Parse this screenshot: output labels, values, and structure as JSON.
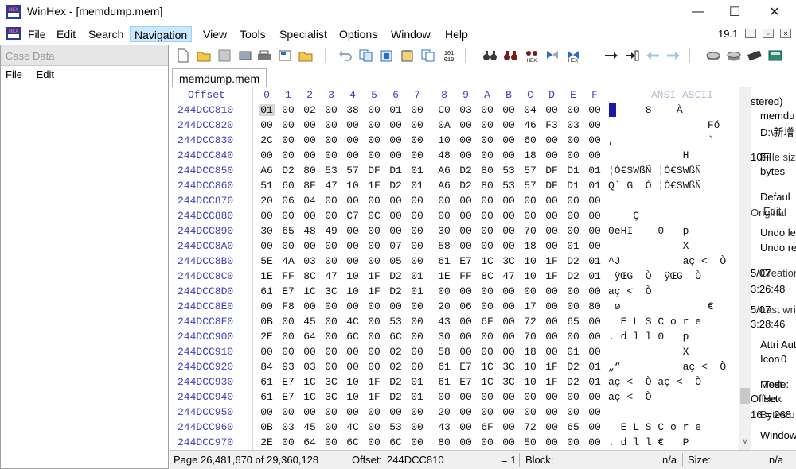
{
  "window": {
    "title": "WinHex - [memdump.mem]",
    "minimize_glyph": "—",
    "maximize_glyph": "☐",
    "close_glyph": "✕"
  },
  "menubar": {
    "items": [
      "File",
      "Edit",
      "Search",
      "Navigation",
      "View",
      "Tools",
      "Specialist",
      "Options",
      "Window",
      "Help"
    ],
    "active": "Navigation",
    "version": "19.1"
  },
  "case_panel": {
    "header": "Case Data",
    "menu": [
      "File",
      "Edit"
    ]
  },
  "toolbar": {
    "icons": [
      "new-file-icon",
      "open-folder-icon",
      "save-icon",
      "print-icon",
      "printer-icon",
      "properties-icon",
      "open-folder-2-icon",
      "undo-icon",
      "copy-icon",
      "paste-icon",
      "paste-special-icon",
      "copy-block-icon",
      "binary-icon",
      "find-text-icon",
      "find-hex-icon",
      "replace-text-icon",
      "replace-hex-icon",
      "hex-search-icon",
      "goto-offset-icon",
      "goto-sector-icon",
      "back-icon",
      "forward-icon",
      "open-disk-icon",
      "open-disks-icon",
      "ram-icon",
      "calculator-icon"
    ],
    "accent_blue": "#2b6cc4",
    "accent_gray": "#9aa6b8"
  },
  "tab": {
    "label": "memdump.mem"
  },
  "hex": {
    "offset_label": "Offset",
    "columns": [
      "0",
      "1",
      "2",
      "3",
      "4",
      "5",
      "6",
      "7",
      "8",
      "9",
      "A",
      "B",
      "C",
      "D",
      "E",
      "F"
    ],
    "ansi_label": "ANSI ASCII",
    "rows": [
      {
        "addr": "244DCC810",
        "bytes": [
          "01",
          "00",
          "02",
          "00",
          "38",
          "00",
          "01",
          "00",
          "C0",
          "03",
          "00",
          "00",
          "04",
          "00",
          "00",
          "00"
        ],
        "ascii": "      8    À"
      },
      {
        "addr": "244DCC820",
        "bytes": [
          "00",
          "00",
          "00",
          "00",
          "00",
          "00",
          "00",
          "00",
          "0A",
          "00",
          "00",
          "00",
          "46",
          "F3",
          "03",
          "00"
        ],
        "ascii": "                Fó"
      },
      {
        "addr": "244DCC830",
        "bytes": [
          "2C",
          "00",
          "00",
          "00",
          "00",
          "00",
          "00",
          "00",
          "10",
          "00",
          "00",
          "00",
          "60",
          "00",
          "00",
          "00"
        ],
        "ascii": ",               `"
      },
      {
        "addr": "244DCC840",
        "bytes": [
          "00",
          "00",
          "00",
          "00",
          "00",
          "00",
          "00",
          "00",
          "48",
          "00",
          "00",
          "00",
          "18",
          "00",
          "00",
          "00"
        ],
        "ascii": "            H"
      },
      {
        "addr": "244DCC850",
        "bytes": [
          "A6",
          "D2",
          "80",
          "53",
          "57",
          "DF",
          "D1",
          "01",
          "A6",
          "D2",
          "80",
          "53",
          "57",
          "DF",
          "D1",
          "01"
        ],
        "ascii": "¦Ò€SWßÑ ¦Ò€SWßÑ"
      },
      {
        "addr": "244DCC860",
        "bytes": [
          "51",
          "60",
          "8F",
          "47",
          "10",
          "1F",
          "D2",
          "01",
          "A6",
          "D2",
          "80",
          "53",
          "57",
          "DF",
          "D1",
          "01"
        ],
        "ascii": "Q` G  Ò ¦Ò€SWßÑ"
      },
      {
        "addr": "244DCC870",
        "bytes": [
          "20",
          "06",
          "04",
          "00",
          "00",
          "00",
          "00",
          "00",
          "00",
          "00",
          "00",
          "00",
          "00",
          "00",
          "00",
          "00"
        ],
        "ascii": ""
      },
      {
        "addr": "244DCC880",
        "bytes": [
          "00",
          "00",
          "00",
          "00",
          "C7",
          "0C",
          "00",
          "00",
          "00",
          "00",
          "00",
          "00",
          "00",
          "00",
          "00",
          "00"
        ],
        "ascii": "    Ç"
      },
      {
        "addr": "244DCC890",
        "bytes": [
          "30",
          "65",
          "48",
          "49",
          "00",
          "00",
          "00",
          "00",
          "30",
          "00",
          "00",
          "00",
          "70",
          "00",
          "00",
          "00"
        ],
        "ascii": "0eHI    0   p"
      },
      {
        "addr": "244DCC8A0",
        "bytes": [
          "00",
          "00",
          "00",
          "00",
          "00",
          "00",
          "07",
          "00",
          "58",
          "00",
          "00",
          "00",
          "18",
          "00",
          "01",
          "00"
        ],
        "ascii": "            X"
      },
      {
        "addr": "244DCC8B0",
        "bytes": [
          "5E",
          "4A",
          "03",
          "00",
          "00",
          "00",
          "05",
          "00",
          "61",
          "E7",
          "1C",
          "3C",
          "10",
          "1F",
          "D2",
          "01"
        ],
        "ascii": "^J          aç <  Ò"
      },
      {
        "addr": "244DCC8C0",
        "bytes": [
          "1E",
          "FF",
          "8C",
          "47",
          "10",
          "1F",
          "D2",
          "01",
          "1E",
          "FF",
          "8C",
          "47",
          "10",
          "1F",
          "D2",
          "01"
        ],
        "ascii": " ÿŒG  Ò  ÿŒG  Ò"
      },
      {
        "addr": "244DCC8D0",
        "bytes": [
          "61",
          "E7",
          "1C",
          "3C",
          "10",
          "1F",
          "D2",
          "01",
          "00",
          "00",
          "00",
          "00",
          "00",
          "00",
          "00",
          "00"
        ],
        "ascii": "aç <  Ò"
      },
      {
        "addr": "244DCC8E0",
        "bytes": [
          "00",
          "F8",
          "00",
          "00",
          "00",
          "00",
          "00",
          "00",
          "20",
          "06",
          "00",
          "00",
          "17",
          "00",
          "00",
          "80"
        ],
        "ascii": " ø              €"
      },
      {
        "addr": "244DCC8F0",
        "bytes": [
          "0B",
          "00",
          "45",
          "00",
          "4C",
          "00",
          "53",
          "00",
          "43",
          "00",
          "6F",
          "00",
          "72",
          "00",
          "65",
          "00"
        ],
        "ascii": "  E L S C o r e"
      },
      {
        "addr": "244DCC900",
        "bytes": [
          "2E",
          "00",
          "64",
          "00",
          "6C",
          "00",
          "6C",
          "00",
          "30",
          "00",
          "00",
          "00",
          "70",
          "00",
          "00",
          "00"
        ],
        "ascii": ". d l l 0   p"
      },
      {
        "addr": "244DCC910",
        "bytes": [
          "00",
          "00",
          "00",
          "00",
          "00",
          "00",
          "02",
          "00",
          "58",
          "00",
          "00",
          "00",
          "18",
          "00",
          "01",
          "00"
        ],
        "ascii": "            X"
      },
      {
        "addr": "244DCC920",
        "bytes": [
          "84",
          "93",
          "03",
          "00",
          "00",
          "00",
          "02",
          "00",
          "61",
          "E7",
          "1C",
          "3C",
          "10",
          "1F",
          "D2",
          "01"
        ],
        "ascii": "„“          aç <  Ò"
      },
      {
        "addr": "244DCC930",
        "bytes": [
          "61",
          "E7",
          "1C",
          "3C",
          "10",
          "1F",
          "D2",
          "01",
          "61",
          "E7",
          "1C",
          "3C",
          "10",
          "1F",
          "D2",
          "01"
        ],
        "ascii": "aç <  Ò aç <  Ò"
      },
      {
        "addr": "244DCC940",
        "bytes": [
          "61",
          "E7",
          "1C",
          "3C",
          "10",
          "1F",
          "D2",
          "01",
          "00",
          "00",
          "00",
          "00",
          "00",
          "00",
          "00",
          "00"
        ],
        "ascii": "aç <  Ò"
      },
      {
        "addr": "244DCC950",
        "bytes": [
          "00",
          "00",
          "00",
          "00",
          "00",
          "00",
          "00",
          "00",
          "20",
          "00",
          "00",
          "00",
          "00",
          "00",
          "00",
          "00"
        ],
        "ascii": ""
      },
      {
        "addr": "244DCC960",
        "bytes": [
          "0B",
          "03",
          "45",
          "00",
          "4C",
          "00",
          "53",
          "00",
          "43",
          "00",
          "6F",
          "00",
          "72",
          "00",
          "65",
          "00"
        ],
        "ascii": "  E L S C o r e"
      },
      {
        "addr": "244DCC970",
        "bytes": [
          "2E",
          "00",
          "64",
          "00",
          "6C",
          "00",
          "6C",
          "00",
          "80",
          "00",
          "00",
          "00",
          "50",
          "00",
          "00",
          "00"
        ],
        "ascii": ". d l l €   P"
      }
    ]
  },
  "info_panel": {
    "lines": [
      "stered)",
      "memdu",
      "D:\\新增",
      "Fil",
      "bytes",
      "Defaul",
      "Undo le",
      "Undo re",
      "3:26:48",
      "3:28:46",
      "Attri",
      "Icon",
      "Mode:",
      "Offset",
      "Bytes p",
      "Window"
    ],
    "overlays": [
      "10:",
      "File size",
      "Edit",
      "Original",
      "5/07",
      "Creation",
      "5/07",
      "Last write",
      "Aut",
      "0",
      "Text",
      "Hex",
      "16 = 268"
    ]
  },
  "status": {
    "page": "Page 26,481,670 of 29,360,128",
    "offset_label": "Offset:",
    "offset_value": "244DCC810",
    "equals": "= 1",
    "block_label": "Block:",
    "block_value": "n/a",
    "size_label": "Size:",
    "size_value": "n/a"
  }
}
